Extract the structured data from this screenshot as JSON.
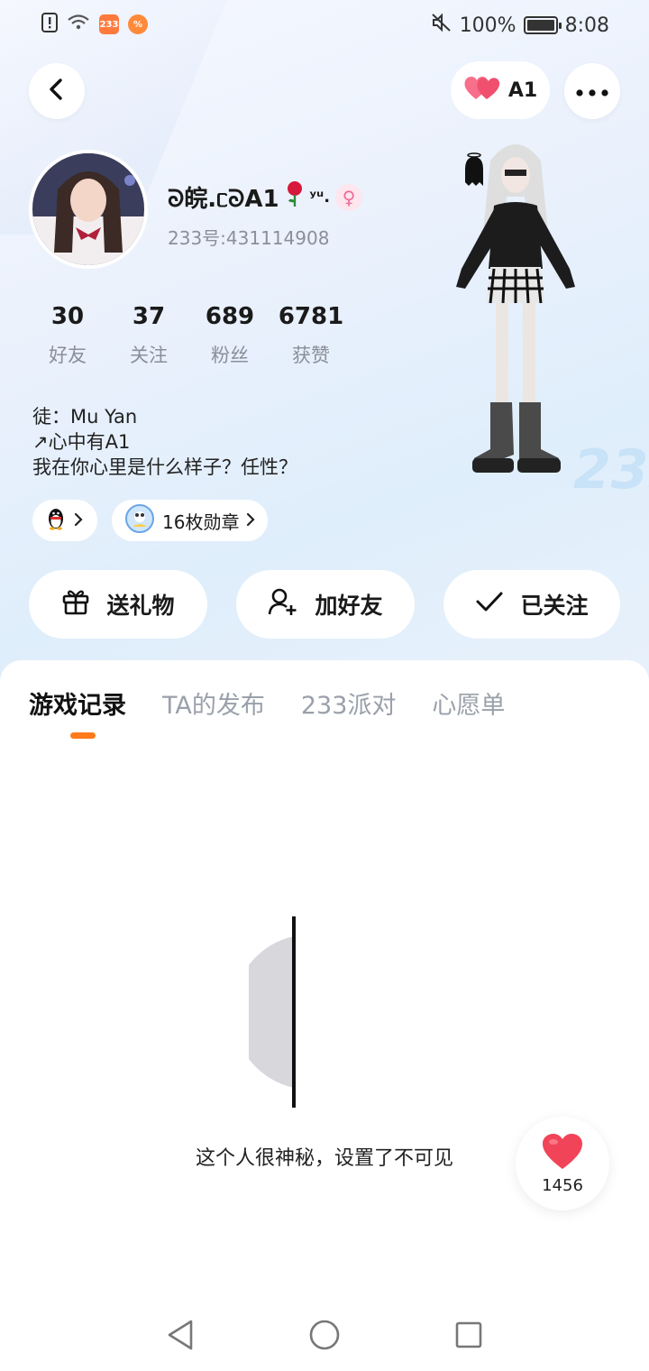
{
  "status_bar": {
    "battery": "100%",
    "time": "8:08",
    "app_badge": "233"
  },
  "header": {
    "a1_label": "A1"
  },
  "profile": {
    "name": "ᘐ皖.ᥴᘐA1",
    "name_suffix": "ʸᵘ.",
    "id_text": "233号:431114908",
    "gender_icon": "female-icon"
  },
  "stats": [
    {
      "value": "30",
      "label": "好友"
    },
    {
      "value": "37",
      "label": "关注"
    },
    {
      "value": "689",
      "label": "粉丝"
    },
    {
      "value": "6781",
      "label": "获赞"
    }
  ],
  "bio": {
    "line1": "徒：Mu Yan",
    "line2": "↗心中有A1",
    "line3": "我在你心里是什么样子？任性？"
  },
  "chips": {
    "medals": "16枚勋章"
  },
  "actions": {
    "gift": "送礼物",
    "add_friend": "加好友",
    "followed": "已关注"
  },
  "tabs": [
    {
      "label": "游戏记录",
      "active": true
    },
    {
      "label": "TA的发布",
      "active": false
    },
    {
      "label": "233派对",
      "active": false
    },
    {
      "label": "心愿单",
      "active": false
    }
  ],
  "empty": {
    "message": "这个人很神秘，设置了不可见"
  },
  "like": {
    "count": "1456"
  },
  "colors": {
    "accent": "#ff7a1a",
    "heart": "#f0506e",
    "gender": "#f06a9a"
  }
}
